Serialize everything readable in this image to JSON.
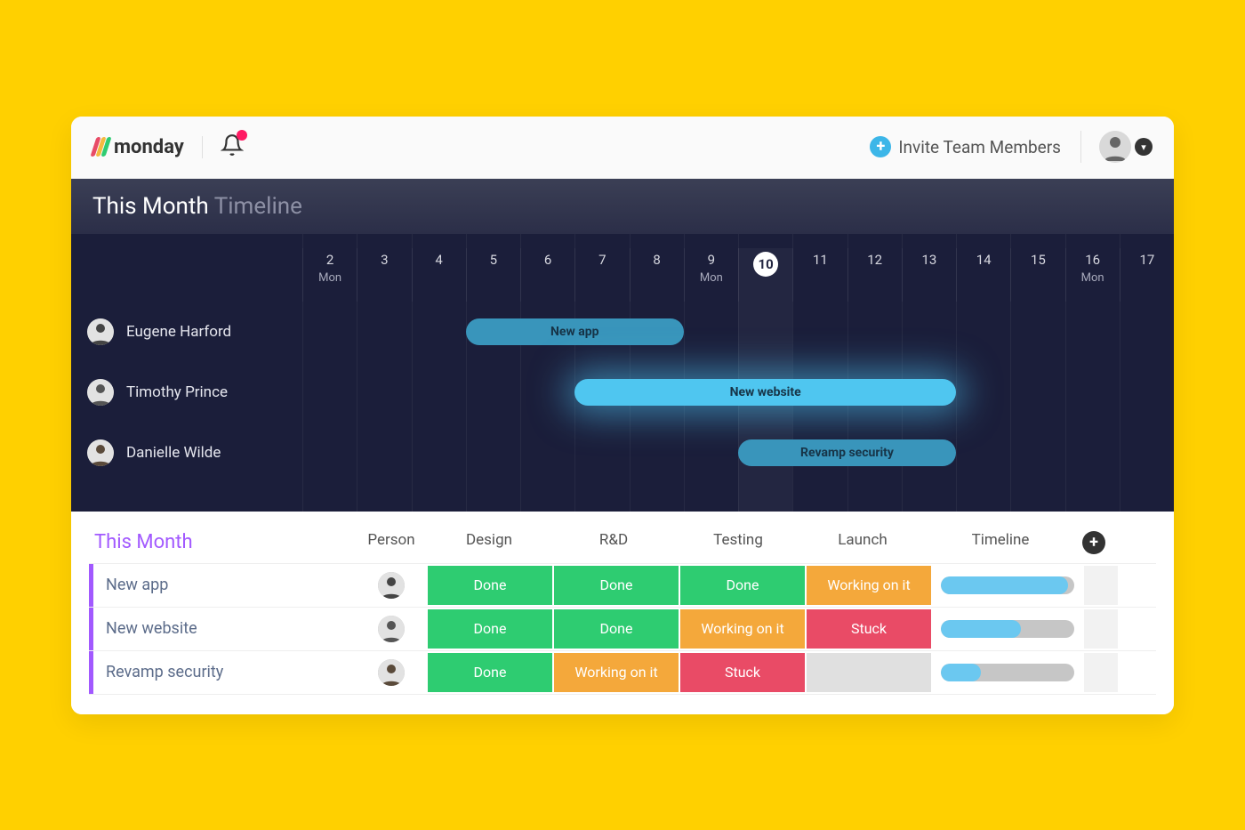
{
  "colors": {
    "logo_stripes": [
      "#e84b66",
      "#f4b940",
      "#2ecc71"
    ],
    "brand_text": "#333333",
    "accent_purple": "#a259ff",
    "bar_standard": "#3995bb",
    "bar_highlight": "#4fc6f0",
    "status_done": "#2ecc71",
    "status_working": "#f4a83b",
    "status_stuck": "#e94b66",
    "status_empty": "#e0e0e0"
  },
  "topbar": {
    "brand": "monday",
    "invite_label": "Invite Team Members"
  },
  "timeline": {
    "title_strong": "This Month",
    "title_muted": "Timeline",
    "day_start": 2,
    "days": [
      {
        "n": 2,
        "sub": "Mon"
      },
      {
        "n": 3,
        "sub": ""
      },
      {
        "n": 4,
        "sub": ""
      },
      {
        "n": 5,
        "sub": ""
      },
      {
        "n": 6,
        "sub": ""
      },
      {
        "n": 7,
        "sub": ""
      },
      {
        "n": 8,
        "sub": ""
      },
      {
        "n": 9,
        "sub": "Mon"
      },
      {
        "n": 10,
        "sub": "",
        "today": true
      },
      {
        "n": 11,
        "sub": ""
      },
      {
        "n": 12,
        "sub": ""
      },
      {
        "n": 13,
        "sub": ""
      },
      {
        "n": 14,
        "sub": ""
      },
      {
        "n": 15,
        "sub": ""
      },
      {
        "n": 16,
        "sub": "Mon"
      },
      {
        "n": 17,
        "sub": ""
      }
    ],
    "rows": [
      {
        "person": "Eugene Harford",
        "bar": {
          "label": "New app",
          "start": 5,
          "end": 8,
          "style": "standard"
        }
      },
      {
        "person": "Timothy Prince",
        "bar": {
          "label": "New website",
          "start": 7,
          "end": 13,
          "style": "highlight"
        }
      },
      {
        "person": "Danielle Wilde",
        "bar": {
          "label": "Revamp security",
          "start": 10,
          "end": 13,
          "style": "standard"
        }
      }
    ]
  },
  "table": {
    "group_title": "This Month",
    "columns": [
      "Person",
      "Design",
      "R&D",
      "Testing",
      "Launch",
      "Timeline"
    ],
    "statuses": {
      "done": "Done",
      "working": "Working on it",
      "stuck": "Stuck",
      "empty": ""
    },
    "rows": [
      {
        "name": "New app",
        "person_idx": 0,
        "cells": [
          "done",
          "done",
          "done",
          "working"
        ],
        "progress": 95
      },
      {
        "name": "New website",
        "person_idx": 1,
        "cells": [
          "done",
          "done",
          "working",
          "stuck"
        ],
        "progress": 60
      },
      {
        "name": "Revamp security",
        "person_idx": 2,
        "cells": [
          "done",
          "working",
          "stuck",
          "empty"
        ],
        "progress": 30
      }
    ]
  }
}
